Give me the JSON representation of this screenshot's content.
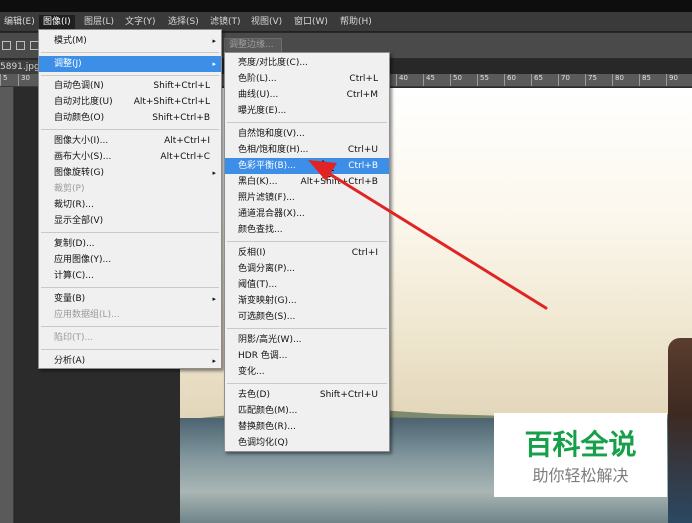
{
  "menubar": [
    {
      "label": "编辑(E)"
    },
    {
      "label": "图像(I)"
    },
    {
      "label": "图层(L)"
    },
    {
      "label": "文字(Y)"
    },
    {
      "label": "选择(S)"
    },
    {
      "label": "滤镜(T)"
    },
    {
      "label": "视图(V)"
    },
    {
      "label": "窗口(W)"
    },
    {
      "label": "帮助(H)"
    }
  ],
  "options": {
    "refine_edge": "调整边缘..."
  },
  "document": {
    "tab_label": "5891.jpg"
  },
  "ruler": {
    "ticks": [
      "5",
      "30",
      "40",
      "45",
      "50",
      "55",
      "60",
      "65",
      "70",
      "75",
      "80",
      "85",
      "90"
    ]
  },
  "image_menu": {
    "items": [
      {
        "label": "模式(M)",
        "shortcut": "",
        "arrow": "▸"
      },
      {
        "label": "调整(J)",
        "shortcut": "",
        "arrow": "▸"
      },
      {
        "label": "自动色调(N)",
        "shortcut": "Shift+Ctrl+L"
      },
      {
        "label": "自动对比度(U)",
        "shortcut": "Alt+Shift+Ctrl+L"
      },
      {
        "label": "自动颜色(O)",
        "shortcut": "Shift+Ctrl+B"
      },
      {
        "label": "图像大小(I)...",
        "shortcut": "Alt+Ctrl+I"
      },
      {
        "label": "画布大小(S)...",
        "shortcut": "Alt+Ctrl+C"
      },
      {
        "label": "图像旋转(G)",
        "shortcut": "",
        "arrow": "▸"
      },
      {
        "label": "裁剪(P)",
        "shortcut": ""
      },
      {
        "label": "裁切(R)...",
        "shortcut": ""
      },
      {
        "label": "显示全部(V)",
        "shortcut": ""
      },
      {
        "label": "复制(D)...",
        "shortcut": ""
      },
      {
        "label": "应用图像(Y)...",
        "shortcut": ""
      },
      {
        "label": "计算(C)...",
        "shortcut": ""
      },
      {
        "label": "变量(B)",
        "shortcut": "",
        "arrow": "▸"
      },
      {
        "label": "应用数据组(L)...",
        "shortcut": ""
      },
      {
        "label": "陷印(T)...",
        "shortcut": ""
      },
      {
        "label": "分析(A)",
        "shortcut": "",
        "arrow": "▸"
      }
    ]
  },
  "adjust_menu": {
    "items": [
      {
        "label": "亮度/对比度(C)...",
        "shortcut": ""
      },
      {
        "label": "色阶(L)...",
        "shortcut": "Ctrl+L"
      },
      {
        "label": "曲线(U)...",
        "shortcut": "Ctrl+M"
      },
      {
        "label": "曝光度(E)...",
        "shortcut": ""
      },
      {
        "label": "自然饱和度(V)...",
        "shortcut": ""
      },
      {
        "label": "色相/饱和度(H)...",
        "shortcut": "Ctrl+U"
      },
      {
        "label": "色彩平衡(B)...",
        "shortcut": "Ctrl+B"
      },
      {
        "label": "黑白(K)...",
        "shortcut": "Alt+Shift+Ctrl+B"
      },
      {
        "label": "照片滤镜(F)...",
        "shortcut": ""
      },
      {
        "label": "通道混合器(X)...",
        "shortcut": ""
      },
      {
        "label": "颜色查找...",
        "shortcut": ""
      },
      {
        "label": "反相(I)",
        "shortcut": "Ctrl+I"
      },
      {
        "label": "色调分离(P)...",
        "shortcut": ""
      },
      {
        "label": "阈值(T)...",
        "shortcut": ""
      },
      {
        "label": "渐变映射(G)...",
        "shortcut": ""
      },
      {
        "label": "可选颜色(S)...",
        "shortcut": ""
      },
      {
        "label": "阴影/高光(W)...",
        "shortcut": ""
      },
      {
        "label": "HDR 色调...",
        "shortcut": ""
      },
      {
        "label": "变化...",
        "shortcut": ""
      },
      {
        "label": "去色(D)",
        "shortcut": "Shift+Ctrl+U"
      },
      {
        "label": "匹配颜色(M)...",
        "shortcut": ""
      },
      {
        "label": "替换颜色(R)...",
        "shortcut": ""
      },
      {
        "label": "色调均化(Q)",
        "shortcut": ""
      }
    ]
  },
  "watermark": {
    "title": "百科全说",
    "subtitle": "助你轻松解决"
  },
  "colors": {
    "highlight": "#3d8ee6",
    "annotation_arrow": "#e02424",
    "watermark_green": "#16a04a"
  }
}
